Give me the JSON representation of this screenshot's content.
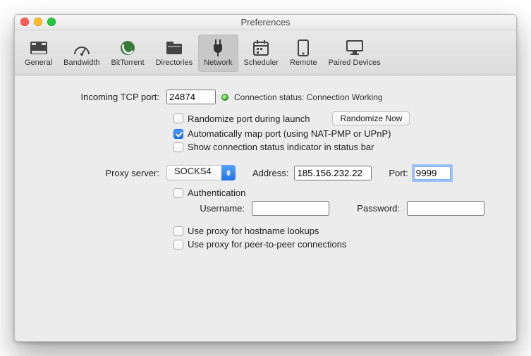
{
  "window": {
    "title": "Preferences"
  },
  "tabs": {
    "general": "General",
    "bandwidth": "Bandwidth",
    "bittorrent": "BitTorrent",
    "directories": "Directories",
    "network": "Network",
    "scheduler": "Scheduler",
    "remote": "Remote",
    "paired": "Paired Devices"
  },
  "net": {
    "tcp_label": "Incoming TCP port:",
    "tcp_value": "24874",
    "status_label": "Connection status: Connection Working",
    "randomize_label": "Randomize port during launch",
    "randomize_now": "Randomize Now",
    "automap_label": "Automatically map port (using NAT-PMP or UPnP)",
    "show_status_label": "Show connection status indicator in status bar"
  },
  "proxy": {
    "server_label": "Proxy server:",
    "type": "SOCKS4",
    "address_label": "Address:",
    "address": "185.156.232.22",
    "port_label": "Port:",
    "port": "9999",
    "auth_label": "Authentication",
    "user_label": "Username:",
    "user": "",
    "pass_label": "Password:",
    "pass": "",
    "use_hostname": "Use proxy for hostname lookups",
    "use_p2p": "Use proxy for peer-to-peer connections"
  }
}
